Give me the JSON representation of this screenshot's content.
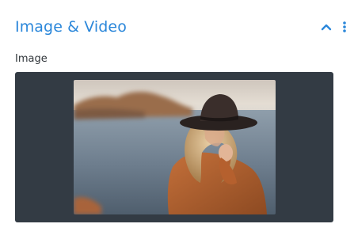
{
  "section": {
    "title": "Image & Video",
    "collapse_icon": "chevron-up-icon",
    "more_icon": "more-vertical-icon",
    "accent_color": "#2b87da"
  },
  "image_field": {
    "label": "Image",
    "background_color": "#333b44",
    "preview_alt": "Woman in a black hat and orange sweater by the sea"
  }
}
